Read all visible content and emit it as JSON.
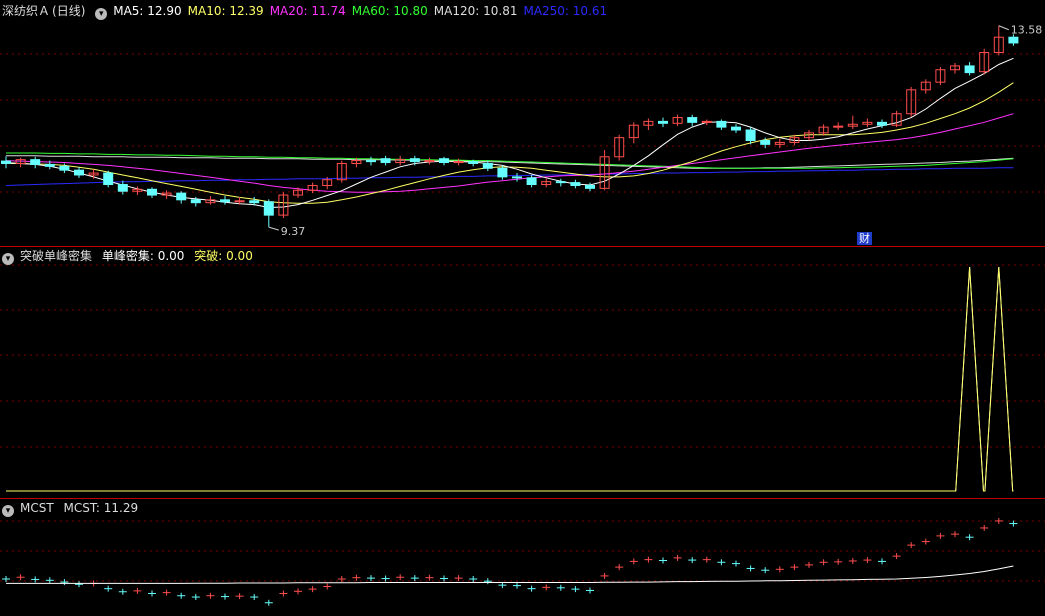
{
  "colors": {
    "ma5": "#ffffff",
    "ma10": "#ffff66",
    "ma20": "#ff33ff",
    "ma60": "#33ff33",
    "ma120": "#dddddd",
    "ma250": "#2a2aff",
    "up": "#ff4d4d",
    "down": "#66ffff",
    "grid": "#7a0000",
    "divider": "#c00000",
    "mcst": "#ffffff",
    "peak": "#ffff66",
    "breakthrough": "#ffffff"
  },
  "main": {
    "stock_name": "深纺织Ａ",
    "period": "(日线)",
    "ma_legend": [
      {
        "key": "ma5",
        "text": "MA5: 12.90"
      },
      {
        "key": "ma10",
        "text": "MA10: 12.39"
      },
      {
        "key": "ma20",
        "text": "MA20: 11.74"
      },
      {
        "key": "ma60",
        "text": "MA60: 10.80"
      },
      {
        "key": "ma120",
        "text": "MA120: 10.81"
      },
      {
        "key": "ma250",
        "text": "MA250: 10.61"
      }
    ],
    "high_label": "13.58",
    "low_label": "9.37",
    "badge": "财",
    "price_range": [
      9.1,
      13.7
    ],
    "candles": [
      [
        10.75,
        10.7,
        10.85,
        10.6
      ],
      [
        10.7,
        10.78,
        10.82,
        10.62
      ],
      [
        10.78,
        10.68,
        10.84,
        10.6
      ],
      [
        10.68,
        10.64,
        10.76,
        10.58
      ],
      [
        10.64,
        10.56,
        10.7,
        10.5
      ],
      [
        10.56,
        10.46,
        10.62,
        10.4
      ],
      [
        10.46,
        10.5,
        10.58,
        10.38
      ],
      [
        10.5,
        10.26,
        10.55,
        10.2
      ],
      [
        10.26,
        10.12,
        10.34,
        10.05
      ],
      [
        10.12,
        10.16,
        10.22,
        10.04
      ],
      [
        10.16,
        10.04,
        10.2,
        9.98
      ],
      [
        10.04,
        10.08,
        10.14,
        9.96
      ],
      [
        10.08,
        9.94,
        10.12,
        9.86
      ],
      [
        9.94,
        9.88,
        10.0,
        9.8
      ],
      [
        9.88,
        9.94,
        10.02,
        9.84
      ],
      [
        9.94,
        9.9,
        10.02,
        9.84
      ],
      [
        9.9,
        9.92,
        10.0,
        9.84
      ],
      [
        9.92,
        9.88,
        10.0,
        9.82
      ],
      [
        9.9,
        9.62,
        9.95,
        9.37
      ],
      [
        9.62,
        10.04,
        10.1,
        9.56
      ],
      [
        10.04,
        10.14,
        10.2,
        9.98
      ],
      [
        10.14,
        10.24,
        10.3,
        10.08
      ],
      [
        10.24,
        10.36,
        10.42,
        10.16
      ],
      [
        10.36,
        10.7,
        10.76,
        10.3
      ],
      [
        10.7,
        10.76,
        10.82,
        10.62
      ],
      [
        10.76,
        10.74,
        10.84,
        10.66
      ],
      [
        10.8,
        10.72,
        10.86,
        10.66
      ],
      [
        10.72,
        10.78,
        10.86,
        10.66
      ],
      [
        10.8,
        10.74,
        10.86,
        10.66
      ],
      [
        10.74,
        10.76,
        10.82,
        10.68
      ],
      [
        10.8,
        10.72,
        10.84,
        10.66
      ],
      [
        10.72,
        10.74,
        10.8,
        10.66
      ],
      [
        10.74,
        10.7,
        10.78,
        10.64
      ],
      [
        10.7,
        10.6,
        10.76,
        10.54
      ],
      [
        10.6,
        10.42,
        10.66,
        10.36
      ],
      [
        10.42,
        10.4,
        10.5,
        10.32
      ],
      [
        10.4,
        10.26,
        10.46,
        10.2
      ],
      [
        10.26,
        10.32,
        10.38,
        10.2
      ],
      [
        10.32,
        10.3,
        10.38,
        10.22
      ],
      [
        10.3,
        10.24,
        10.36,
        10.18
      ],
      [
        10.24,
        10.18,
        10.3,
        10.12
      ],
      [
        10.18,
        10.84,
        10.98,
        10.14
      ],
      [
        10.84,
        11.24,
        11.3,
        10.76
      ],
      [
        11.24,
        11.5,
        11.56,
        11.12
      ],
      [
        11.5,
        11.58,
        11.64,
        11.4
      ],
      [
        11.58,
        11.54,
        11.66,
        11.46
      ],
      [
        11.54,
        11.66,
        11.72,
        11.48
      ],
      [
        11.66,
        11.56,
        11.72,
        11.48
      ],
      [
        11.56,
        11.58,
        11.62,
        11.5
      ],
      [
        11.58,
        11.46,
        11.62,
        11.4
      ],
      [
        11.46,
        11.4,
        11.52,
        11.34
      ],
      [
        11.4,
        11.18,
        11.46,
        11.1
      ],
      [
        11.18,
        11.1,
        11.24,
        11.02
      ],
      [
        11.1,
        11.14,
        11.22,
        11.02
      ],
      [
        11.14,
        11.24,
        11.3,
        11.08
      ],
      [
        11.24,
        11.34,
        11.4,
        11.18
      ],
      [
        11.34,
        11.46,
        11.52,
        11.28
      ],
      [
        11.46,
        11.48,
        11.56,
        11.4
      ],
      [
        11.48,
        11.52,
        11.7,
        11.42
      ],
      [
        11.52,
        11.56,
        11.64,
        11.46
      ],
      [
        11.56,
        11.5,
        11.62,
        11.44
      ],
      [
        11.5,
        11.74,
        11.8,
        11.46
      ],
      [
        11.74,
        12.24,
        12.3,
        11.68
      ],
      [
        12.24,
        12.4,
        12.46,
        12.16
      ],
      [
        12.4,
        12.66,
        12.72,
        12.34
      ],
      [
        12.66,
        12.74,
        12.8,
        12.58
      ],
      [
        12.74,
        12.6,
        12.82,
        12.54
      ],
      [
        12.62,
        13.02,
        13.1,
        12.56
      ],
      [
        13.02,
        13.34,
        13.58,
        12.96
      ],
      [
        13.34,
        13.22,
        13.4,
        13.16
      ]
    ],
    "ma_series": {
      "ma5": [
        10.72,
        10.7,
        10.68,
        10.64,
        10.58,
        10.5,
        10.42,
        10.33,
        10.25,
        10.17,
        10.1,
        10.04,
        9.99,
        9.96,
        9.93,
        9.89,
        9.86,
        9.84,
        9.78,
        9.79,
        9.84,
        9.93,
        10.03,
        10.13,
        10.27,
        10.41,
        10.52,
        10.63,
        10.7,
        10.73,
        10.75,
        10.74,
        10.73,
        10.7,
        10.66,
        10.58,
        10.48,
        10.4,
        10.33,
        10.27,
        10.25,
        10.33,
        10.48,
        10.66,
        10.86,
        11.09,
        11.31,
        11.46,
        11.56,
        11.57,
        11.55,
        11.46,
        11.34,
        11.24,
        11.18,
        11.18,
        11.21,
        11.26,
        11.34,
        11.42,
        11.49,
        11.55,
        11.66,
        11.84,
        12.06,
        12.27,
        12.42,
        12.58,
        12.77,
        12.9
      ],
      "ma10": [
        10.7,
        10.7,
        10.69,
        10.68,
        10.66,
        10.62,
        10.58,
        10.52,
        10.46,
        10.4,
        10.34,
        10.28,
        10.22,
        10.16,
        10.1,
        10.04,
        9.99,
        9.95,
        9.9,
        9.88,
        9.87,
        9.87,
        9.89,
        9.94,
        10.0,
        10.07,
        10.14,
        10.22,
        10.3,
        10.38,
        10.45,
        10.52,
        10.57,
        10.61,
        10.63,
        10.62,
        10.6,
        10.56,
        10.52,
        10.48,
        10.44,
        10.42,
        10.42,
        10.44,
        10.49,
        10.56,
        10.65,
        10.74,
        10.85,
        10.96,
        11.05,
        11.13,
        11.2,
        11.25,
        11.28,
        11.3,
        11.3,
        11.3,
        11.3,
        11.32,
        11.35,
        11.4,
        11.46,
        11.54,
        11.64,
        11.74,
        11.86,
        12.01,
        12.19,
        12.39
      ],
      "ma20": [
        10.76,
        10.75,
        10.74,
        10.73,
        10.72,
        10.7,
        10.68,
        10.66,
        10.63,
        10.6,
        10.57,
        10.53,
        10.49,
        10.45,
        10.41,
        10.37,
        10.33,
        10.29,
        10.24,
        10.2,
        10.17,
        10.14,
        10.12,
        10.11,
        10.1,
        10.1,
        10.11,
        10.12,
        10.14,
        10.17,
        10.2,
        10.23,
        10.27,
        10.31,
        10.34,
        10.37,
        10.4,
        10.42,
        10.44,
        10.45,
        10.46,
        10.48,
        10.51,
        10.54,
        10.58,
        10.62,
        10.66,
        10.7,
        10.74,
        10.78,
        10.82,
        10.86,
        10.9,
        10.94,
        10.98,
        11.02,
        11.05,
        11.08,
        11.11,
        11.14,
        11.17,
        11.2,
        11.24,
        11.29,
        11.35,
        11.42,
        11.49,
        11.56,
        11.65,
        11.74
      ],
      "ma60": [
        10.92,
        10.92,
        10.92,
        10.91,
        10.91,
        10.9,
        10.9,
        10.89,
        10.89,
        10.88,
        10.88,
        10.87,
        10.87,
        10.86,
        10.85,
        10.85,
        10.84,
        10.84,
        10.83,
        10.83,
        10.82,
        10.82,
        10.81,
        10.81,
        10.8,
        10.8,
        10.79,
        10.79,
        10.78,
        10.78,
        10.77,
        10.77,
        10.76,
        10.76,
        10.75,
        10.74,
        10.73,
        10.72,
        10.71,
        10.7,
        10.69,
        10.68,
        10.67,
        10.66,
        10.65,
        10.64,
        10.63,
        10.62,
        10.61,
        10.6,
        10.6,
        10.6,
        10.6,
        10.6,
        10.6,
        10.6,
        10.61,
        10.61,
        10.62,
        10.62,
        10.63,
        10.64,
        10.65,
        10.66,
        10.68,
        10.7,
        10.72,
        10.74,
        10.77,
        10.8
      ],
      "ma120": [
        10.86,
        10.86,
        10.86,
        10.85,
        10.85,
        10.85,
        10.84,
        10.84,
        10.84,
        10.83,
        10.83,
        10.83,
        10.82,
        10.82,
        10.82,
        10.81,
        10.81,
        10.81,
        10.8,
        10.8,
        10.8,
        10.79,
        10.79,
        10.79,
        10.78,
        10.78,
        10.78,
        10.77,
        10.77,
        10.77,
        10.76,
        10.76,
        10.75,
        10.74,
        10.73,
        10.72,
        10.71,
        10.7,
        10.69,
        10.68,
        10.67,
        10.66,
        10.65,
        10.64,
        10.63,
        10.62,
        10.61,
        10.6,
        10.6,
        10.6,
        10.6,
        10.6,
        10.61,
        10.61,
        10.62,
        10.63,
        10.64,
        10.65,
        10.66,
        10.67,
        10.68,
        10.69,
        10.7,
        10.71,
        10.72,
        10.74,
        10.75,
        10.77,
        10.79,
        10.81
      ],
      "ma250": [
        10.24,
        10.25,
        10.26,
        10.27,
        10.28,
        10.29,
        10.3,
        10.31,
        10.32,
        10.32,
        10.33,
        10.33,
        10.34,
        10.34,
        10.35,
        10.35,
        10.36,
        10.36,
        10.37,
        10.37,
        10.38,
        10.38,
        10.38,
        10.39,
        10.39,
        10.4,
        10.4,
        10.41,
        10.41,
        10.42,
        10.42,
        10.43,
        10.43,
        10.44,
        10.44,
        10.45,
        10.45,
        10.46,
        10.46,
        10.47,
        10.47,
        10.48,
        10.48,
        10.49,
        10.49,
        10.5,
        10.5,
        10.51,
        10.51,
        10.52,
        10.52,
        10.53,
        10.53,
        10.54,
        10.54,
        10.55,
        10.55,
        10.56,
        10.56,
        10.57,
        10.57,
        10.58,
        10.58,
        10.59,
        10.59,
        10.6,
        10.6,
        10.6,
        10.61,
        10.61
      ]
    }
  },
  "indicator": {
    "name": "突破单峰密集",
    "line1_text": "单峰密集: 0.00",
    "line2_text": "突破: 0.00",
    "peak_series": [
      0,
      0,
      0,
      0,
      0,
      0,
      0,
      0,
      0,
      0,
      0,
      0,
      0,
      0,
      0,
      0,
      0,
      0,
      0,
      0,
      0,
      0,
      0,
      0,
      0,
      0,
      0,
      0,
      0,
      0,
      0,
      0,
      0,
      0,
      0,
      0,
      0,
      0,
      0,
      0,
      0,
      0,
      0,
      0,
      0,
      0,
      0,
      0,
      0,
      0,
      0,
      0,
      0,
      0,
      0,
      0,
      0,
      0,
      0,
      0,
      0,
      0,
      0,
      0,
      0,
      0,
      1,
      0,
      1,
      0
    ],
    "break_series": [
      0,
      0,
      0,
      0,
      0,
      0,
      0,
      0,
      0,
      0,
      0,
      0,
      0,
      0,
      0,
      0,
      0,
      0,
      0,
      0,
      0,
      0,
      0,
      0,
      0,
      0,
      0,
      0,
      0,
      0,
      0,
      0,
      0,
      0,
      0,
      0,
      0,
      0,
      0,
      0,
      0,
      0,
      0,
      0,
      0,
      0,
      0,
      0,
      0,
      0,
      0,
      0,
      0,
      0,
      0,
      0,
      0,
      0,
      0,
      0,
      0,
      0,
      0,
      0,
      0,
      0,
      1,
      0,
      1,
      0
    ]
  },
  "mcst": {
    "name": "MCST",
    "value_text": "MCST: 11.29",
    "series": [
      10.5,
      10.5,
      10.5,
      10.5,
      10.5,
      10.5,
      10.5,
      10.5,
      10.5,
      10.5,
      10.5,
      10.5,
      10.5,
      10.51,
      10.51,
      10.51,
      10.52,
      10.52,
      10.52,
      10.52,
      10.53,
      10.53,
      10.53,
      10.53,
      10.53,
      10.54,
      10.54,
      10.54,
      10.54,
      10.54,
      10.54,
      10.54,
      10.54,
      10.54,
      10.54,
      10.54,
      10.54,
      10.54,
      10.54,
      10.54,
      10.54,
      10.55,
      10.55,
      10.56,
      10.56,
      10.57,
      10.58,
      10.58,
      10.59,
      10.6,
      10.6,
      10.61,
      10.62,
      10.62,
      10.63,
      10.64,
      10.65,
      10.66,
      10.67,
      10.68,
      10.69,
      10.7,
      10.73,
      10.77,
      10.82,
      10.88,
      10.95,
      11.04,
      11.16,
      11.29
    ]
  }
}
